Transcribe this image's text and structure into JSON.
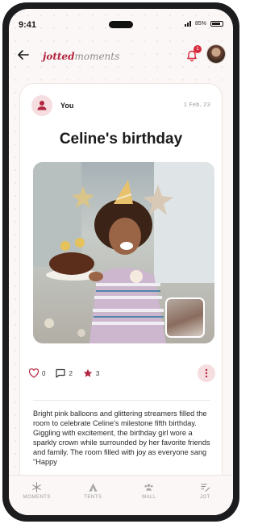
{
  "status_bar": {
    "time": "9:41",
    "battery": "85%"
  },
  "header": {
    "logo_part1": "jotted",
    "logo_part2": "moments",
    "notification_count": "1"
  },
  "post": {
    "author": "You",
    "date": "1 Feb, 23",
    "title": "Celine's birthday",
    "likes": "0",
    "comments": "2",
    "stars": "3",
    "description": "Bright pink balloons and glittering streamers filled the room to celebrate Celine's milestone fifth birthday. Giggling with excitement, the birthday girl wore a sparkly crown while surrounded by her favorite friends and family. The room filled with joy as everyone sang \"Happy"
  },
  "nav": {
    "items": [
      {
        "label": "MOMENTS",
        "icon": "snowflake-icon"
      },
      {
        "label": "TENTS",
        "icon": "tent-icon"
      },
      {
        "label": "WALL",
        "icon": "people-icon"
      },
      {
        "label": "JOT",
        "icon": "jot-icon"
      }
    ]
  },
  "colors": {
    "accent": "#b2243e",
    "badge": "#d62b3f",
    "soft_pink": "#f6dde0"
  }
}
